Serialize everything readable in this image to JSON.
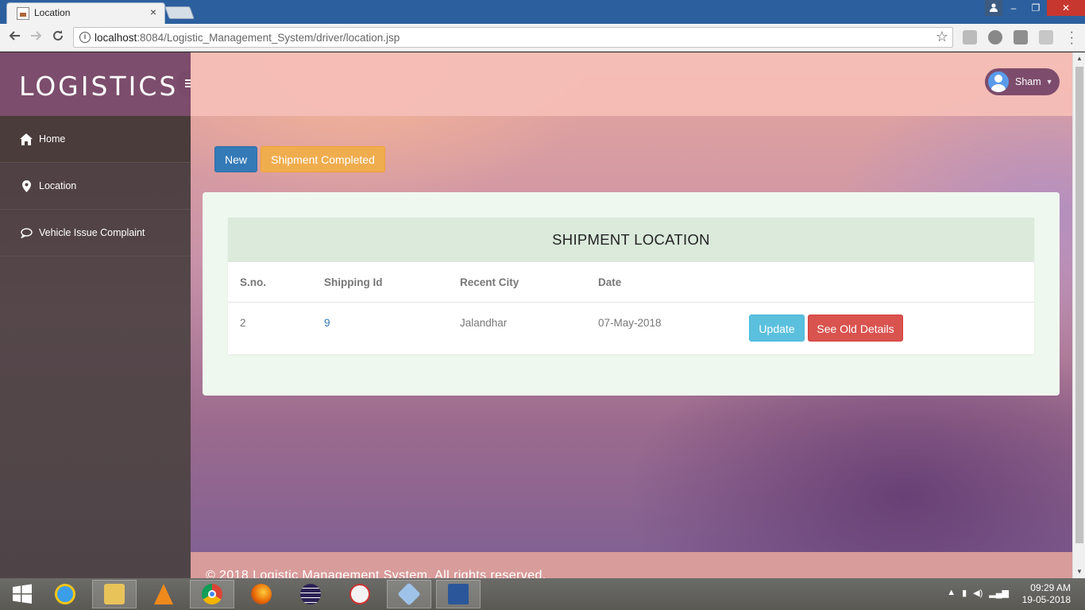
{
  "browser": {
    "tab_title": "Location",
    "tab_close": "×",
    "url_host": "localhost",
    "url_path": ":8084/Logistic_Management_System/driver/location.jsp",
    "window_buttons": [
      "–",
      "❐",
      "✕"
    ]
  },
  "sidebar": {
    "brand": "LOGISTICS",
    "items": [
      {
        "label": "Home",
        "icon": "home-icon"
      },
      {
        "label": "Location",
        "icon": "map-marker-icon"
      },
      {
        "label": "Vehicle Issue Complaint",
        "icon": "comment-icon"
      }
    ]
  },
  "header": {
    "user_name": "Sham"
  },
  "actions": {
    "new_label": "New",
    "completed_label": "Shipment Completed"
  },
  "table": {
    "title": "SHIPMENT LOCATION",
    "columns": [
      "S.no.",
      "Shipping Id",
      "Recent City",
      "Date"
    ],
    "rows": [
      {
        "sno": "2",
        "shipping_id": "9",
        "recent_city": "Jalandhar",
        "date": "07-May-2018",
        "update_label": "Update",
        "old_details_label": "See Old Details"
      }
    ]
  },
  "footer": {
    "text": "© 2018 Logistic Management System. All rights reserved."
  },
  "taskbar": {
    "time": "09:29 AM",
    "date": "19-05-2018"
  },
  "colors": {
    "primary": "#337ab7",
    "warning": "#f0ad4e",
    "info": "#5bc0de",
    "danger": "#d9534f",
    "brand": "#7c4d6c"
  }
}
